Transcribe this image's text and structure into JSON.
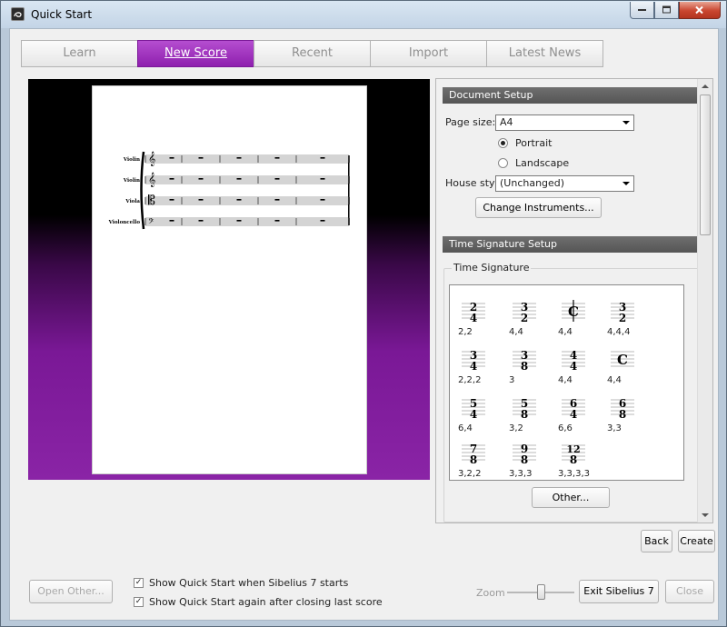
{
  "window": {
    "title": "Quick Start"
  },
  "tabs": [
    {
      "label": "Learn"
    },
    {
      "label": "New Score"
    },
    {
      "label": "Recent"
    },
    {
      "label": "Import"
    },
    {
      "label": "Latest News"
    }
  ],
  "score_preview": {
    "staves": [
      {
        "name": "Violin"
      },
      {
        "name": "Violin"
      },
      {
        "name": "Viola"
      },
      {
        "name": "Violoncello"
      }
    ]
  },
  "document_setup": {
    "header": "Document Setup",
    "page_size_label": "Page size:",
    "page_size_value": "A4",
    "portrait_label": "Portrait",
    "landscape_label": "Landscape",
    "orientation_selected": "Portrait",
    "house_style_label": "House style",
    "house_style_value": "(Unchanged)",
    "change_instruments_label": "Change Instruments..."
  },
  "time_signature_setup": {
    "header": "Time Signature Setup",
    "group_label": "Time Signature",
    "signatures": [
      {
        "top": "2",
        "bottom": "4",
        "grouping": "2,2"
      },
      {
        "top": "3",
        "bottom": "2",
        "grouping": "4,4"
      },
      {
        "symbol": "cut-time",
        "grouping": "4,4"
      },
      {
        "top": "3",
        "bottom": "2",
        "grouping": "4,4,4"
      },
      {
        "top": "3",
        "bottom": "4",
        "grouping": "2,2,2"
      },
      {
        "top": "3",
        "bottom": "8",
        "grouping": "3"
      },
      {
        "top": "4",
        "bottom": "4",
        "grouping": "4,4"
      },
      {
        "symbol": "common-time",
        "grouping": "4,4"
      },
      {
        "top": "5",
        "bottom": "4",
        "grouping": "6,4"
      },
      {
        "top": "5",
        "bottom": "8",
        "grouping": "3,2"
      },
      {
        "top": "6",
        "bottom": "4",
        "grouping": "6,6"
      },
      {
        "top": "6",
        "bottom": "8",
        "grouping": "3,3"
      },
      {
        "top": "7",
        "bottom": "8",
        "grouping": "3,2,2"
      },
      {
        "top": "9",
        "bottom": "8",
        "grouping": "3,3,3"
      },
      {
        "top": "12",
        "bottom": "8",
        "grouping": "3,3,3,3"
      }
    ],
    "other_label": "Other..."
  },
  "actions": {
    "back_label": "Back",
    "create_label": "Create",
    "open_other_label": "Open Other...",
    "exit_label": "Exit Sibelius 7",
    "close_label": "Close"
  },
  "options": {
    "show_on_start_label": "Show Quick Start when Sibelius 7 starts",
    "show_on_start_checked": true,
    "show_after_close_label": "Show Quick Start again after closing last score",
    "show_after_close_checked": true
  },
  "zoom": {
    "label": "Zoom"
  },
  "colors": {
    "accent": "#9a2bbd",
    "preview_purple": "#8a24a6"
  }
}
